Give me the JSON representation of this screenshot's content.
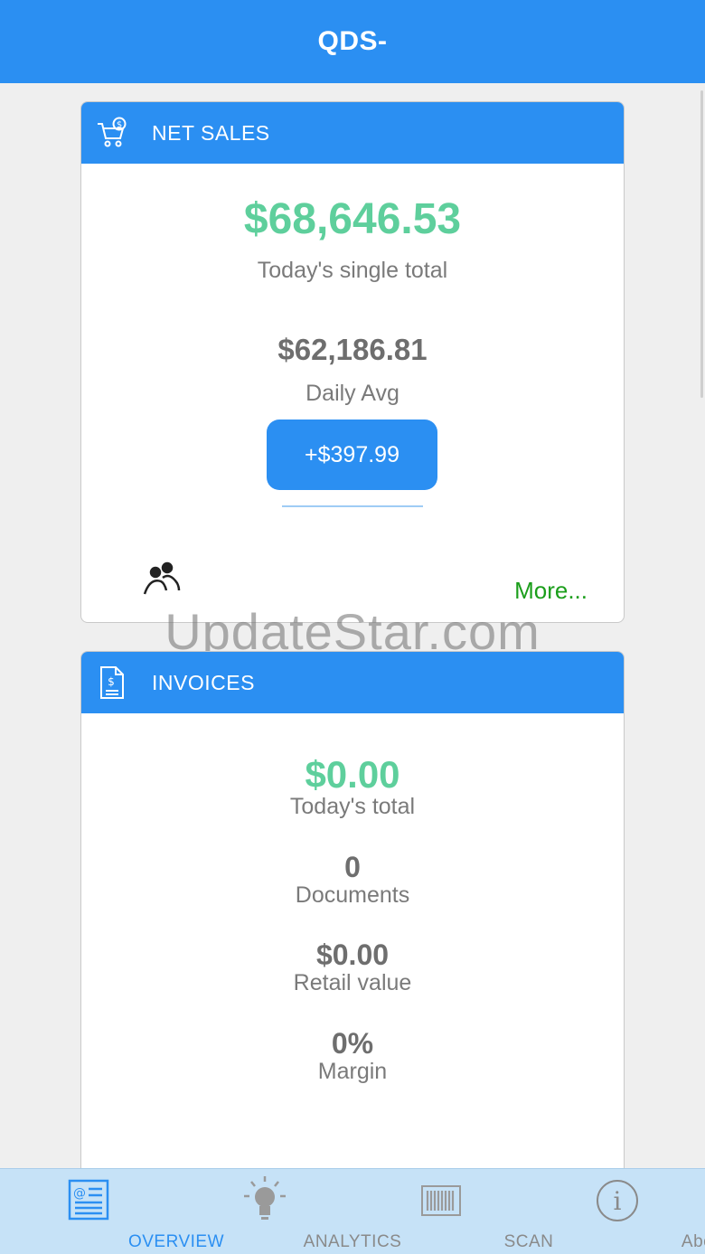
{
  "app": {
    "title": "QDS-"
  },
  "net_sales": {
    "header": "NET SALES",
    "today_total": "$68,646.53",
    "today_label": "Today's single total",
    "daily_avg": "$62,186.81",
    "daily_avg_label": "Daily Avg",
    "delta": "+$397.99",
    "more": "More..."
  },
  "invoices": {
    "header": "INVOICES",
    "today_total": "$0.00",
    "today_label": "Today's total",
    "documents": "0",
    "documents_label": "Documents",
    "retail_value": "$0.00",
    "retail_label": "Retail value",
    "margin": "0%",
    "margin_label": "Margin"
  },
  "watermark": "UpdateStar.com",
  "tabbar": {
    "tabs": [
      {
        "label": "OVERVIEW",
        "icon": "overview-icon",
        "active": true
      },
      {
        "label": "ANALYTICS",
        "icon": "lightbulb-icon",
        "active": false
      },
      {
        "label": "SCAN",
        "icon": "barcode-icon",
        "active": false
      },
      {
        "label": "About",
        "icon": "info-icon",
        "active": false
      }
    ]
  },
  "colors": {
    "primary": "#2b8ff2",
    "green_value": "#5ecf9c",
    "more_link": "#1b9e1b",
    "tabbar_bg": "#c6e2f7"
  }
}
